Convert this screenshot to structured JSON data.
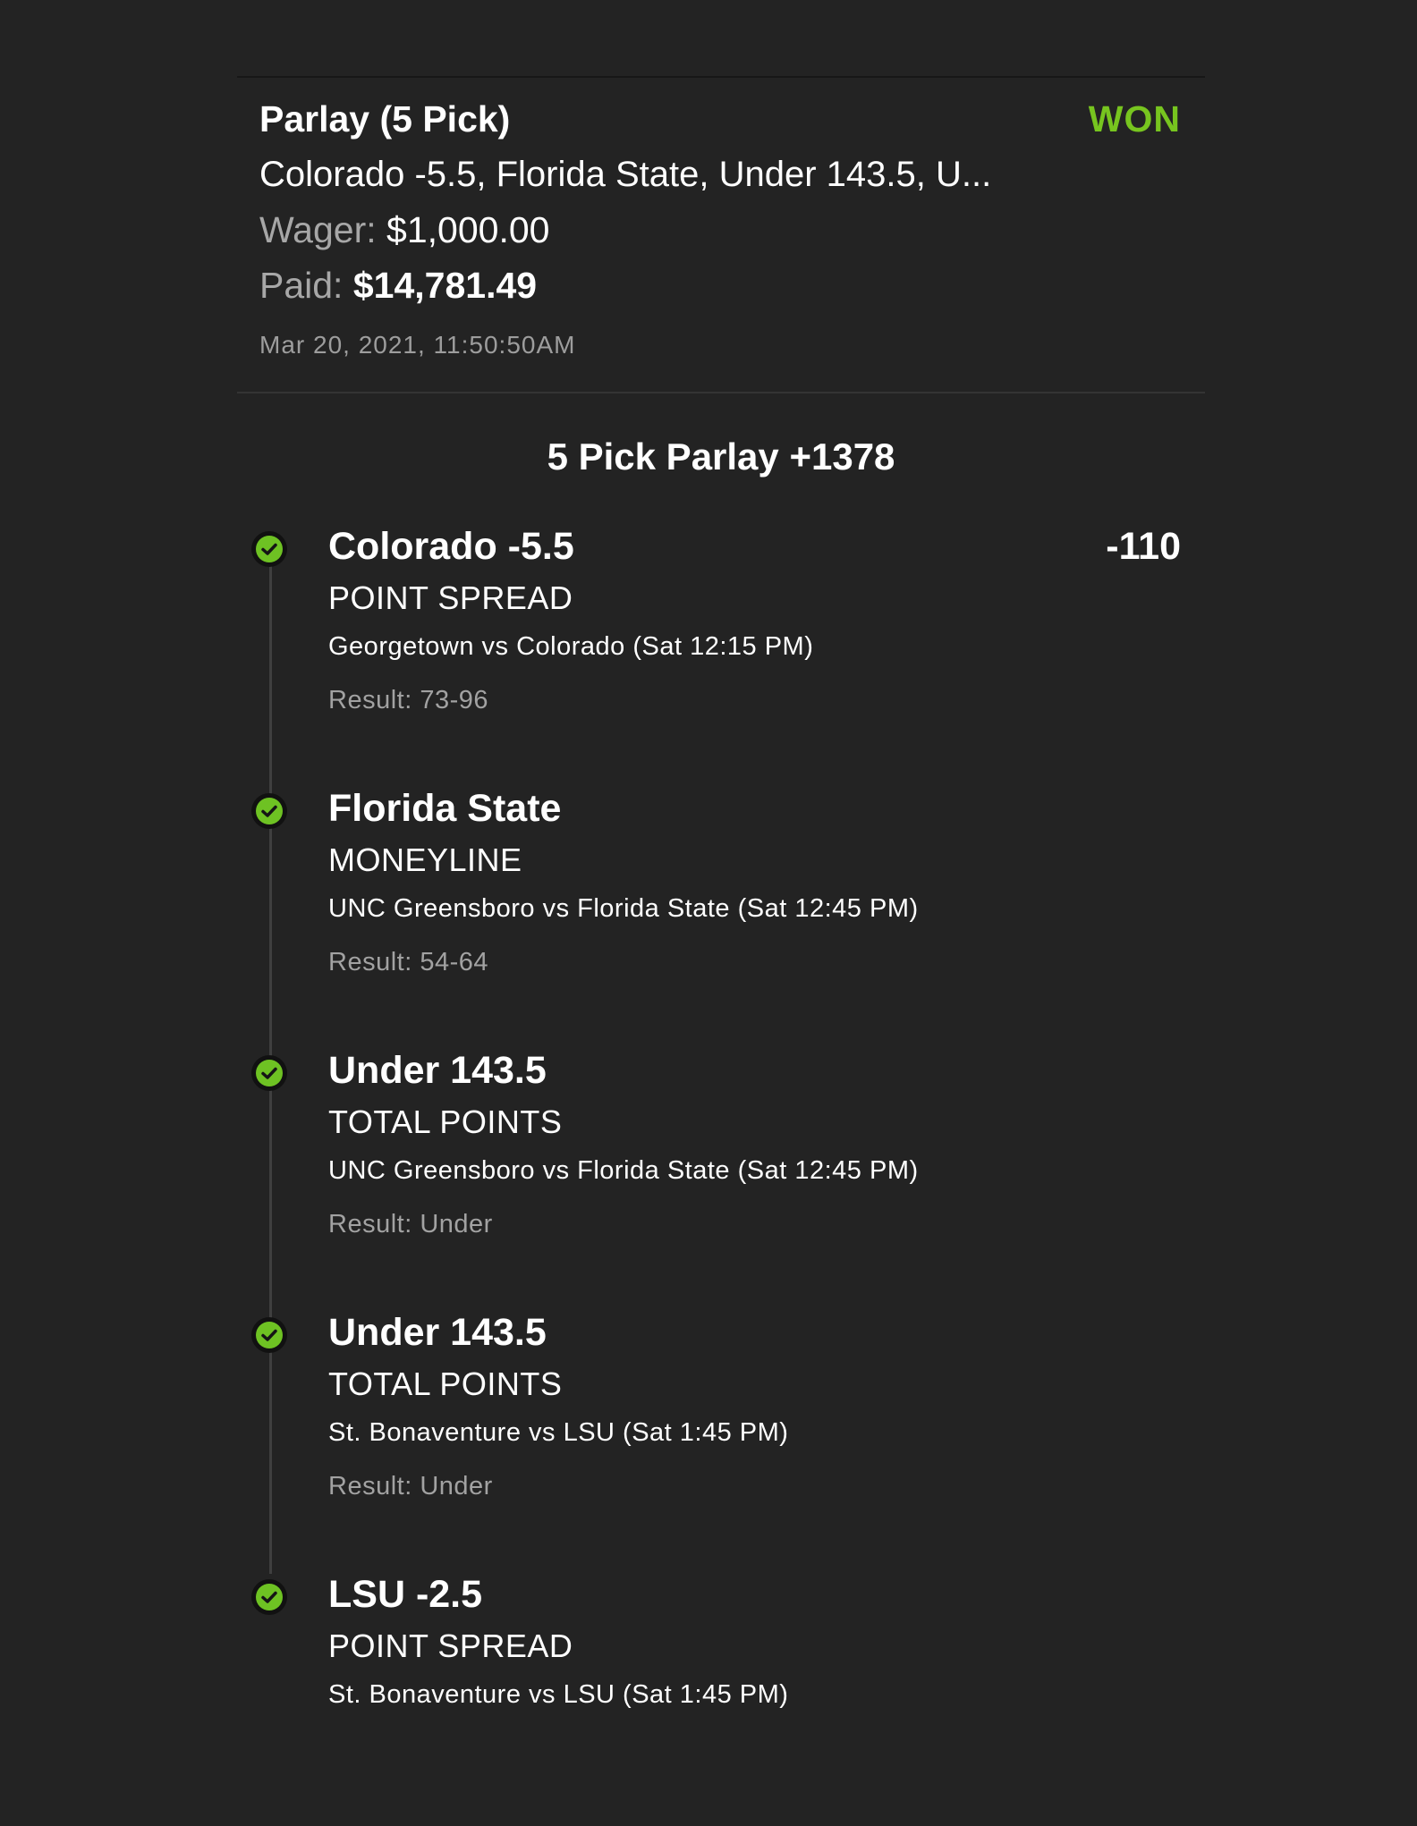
{
  "bet": {
    "title": "Parlay (5 Pick)",
    "status": "WON",
    "status_color": "#77c51f",
    "picks_summary": "Colorado -5.5, Florida State, Under 143.5, U...",
    "wager_label": "Wager:",
    "wager_value": "$1,000.00",
    "paid_label": "Paid:",
    "paid_value": "$14,781.49",
    "timestamp": "Mar 20, 2021, 11:50:50AM"
  },
  "parlay": {
    "heading": "5 Pick Parlay +1378"
  },
  "icons": {
    "leg_status": "check-circle-icon",
    "check_color": "#6ec223"
  },
  "legs": [
    {
      "selection": "Colorado -5.5",
      "odds": "-110",
      "market": "POINT SPREAD",
      "matchup": "Georgetown vs Colorado (Sat 12:15 PM)",
      "result": "Result: 73-96"
    },
    {
      "selection": "Florida State",
      "odds": "",
      "market": "MONEYLINE",
      "matchup": "UNC Greensboro vs Florida State (Sat 12:45 PM)",
      "result": "Result: 54-64"
    },
    {
      "selection": "Under 143.5",
      "odds": "",
      "market": "TOTAL POINTS",
      "matchup": "UNC Greensboro vs Florida State (Sat 12:45 PM)",
      "result": "Result: Under"
    },
    {
      "selection": "Under 143.5",
      "odds": "",
      "market": "TOTAL POINTS",
      "matchup": "St. Bonaventure vs LSU (Sat 1:45 PM)",
      "result": "Result: Under"
    },
    {
      "selection": "LSU -2.5",
      "odds": "",
      "market": "POINT SPREAD",
      "matchup": "St. Bonaventure vs LSU (Sat 1:45 PM)",
      "result": ""
    }
  ]
}
